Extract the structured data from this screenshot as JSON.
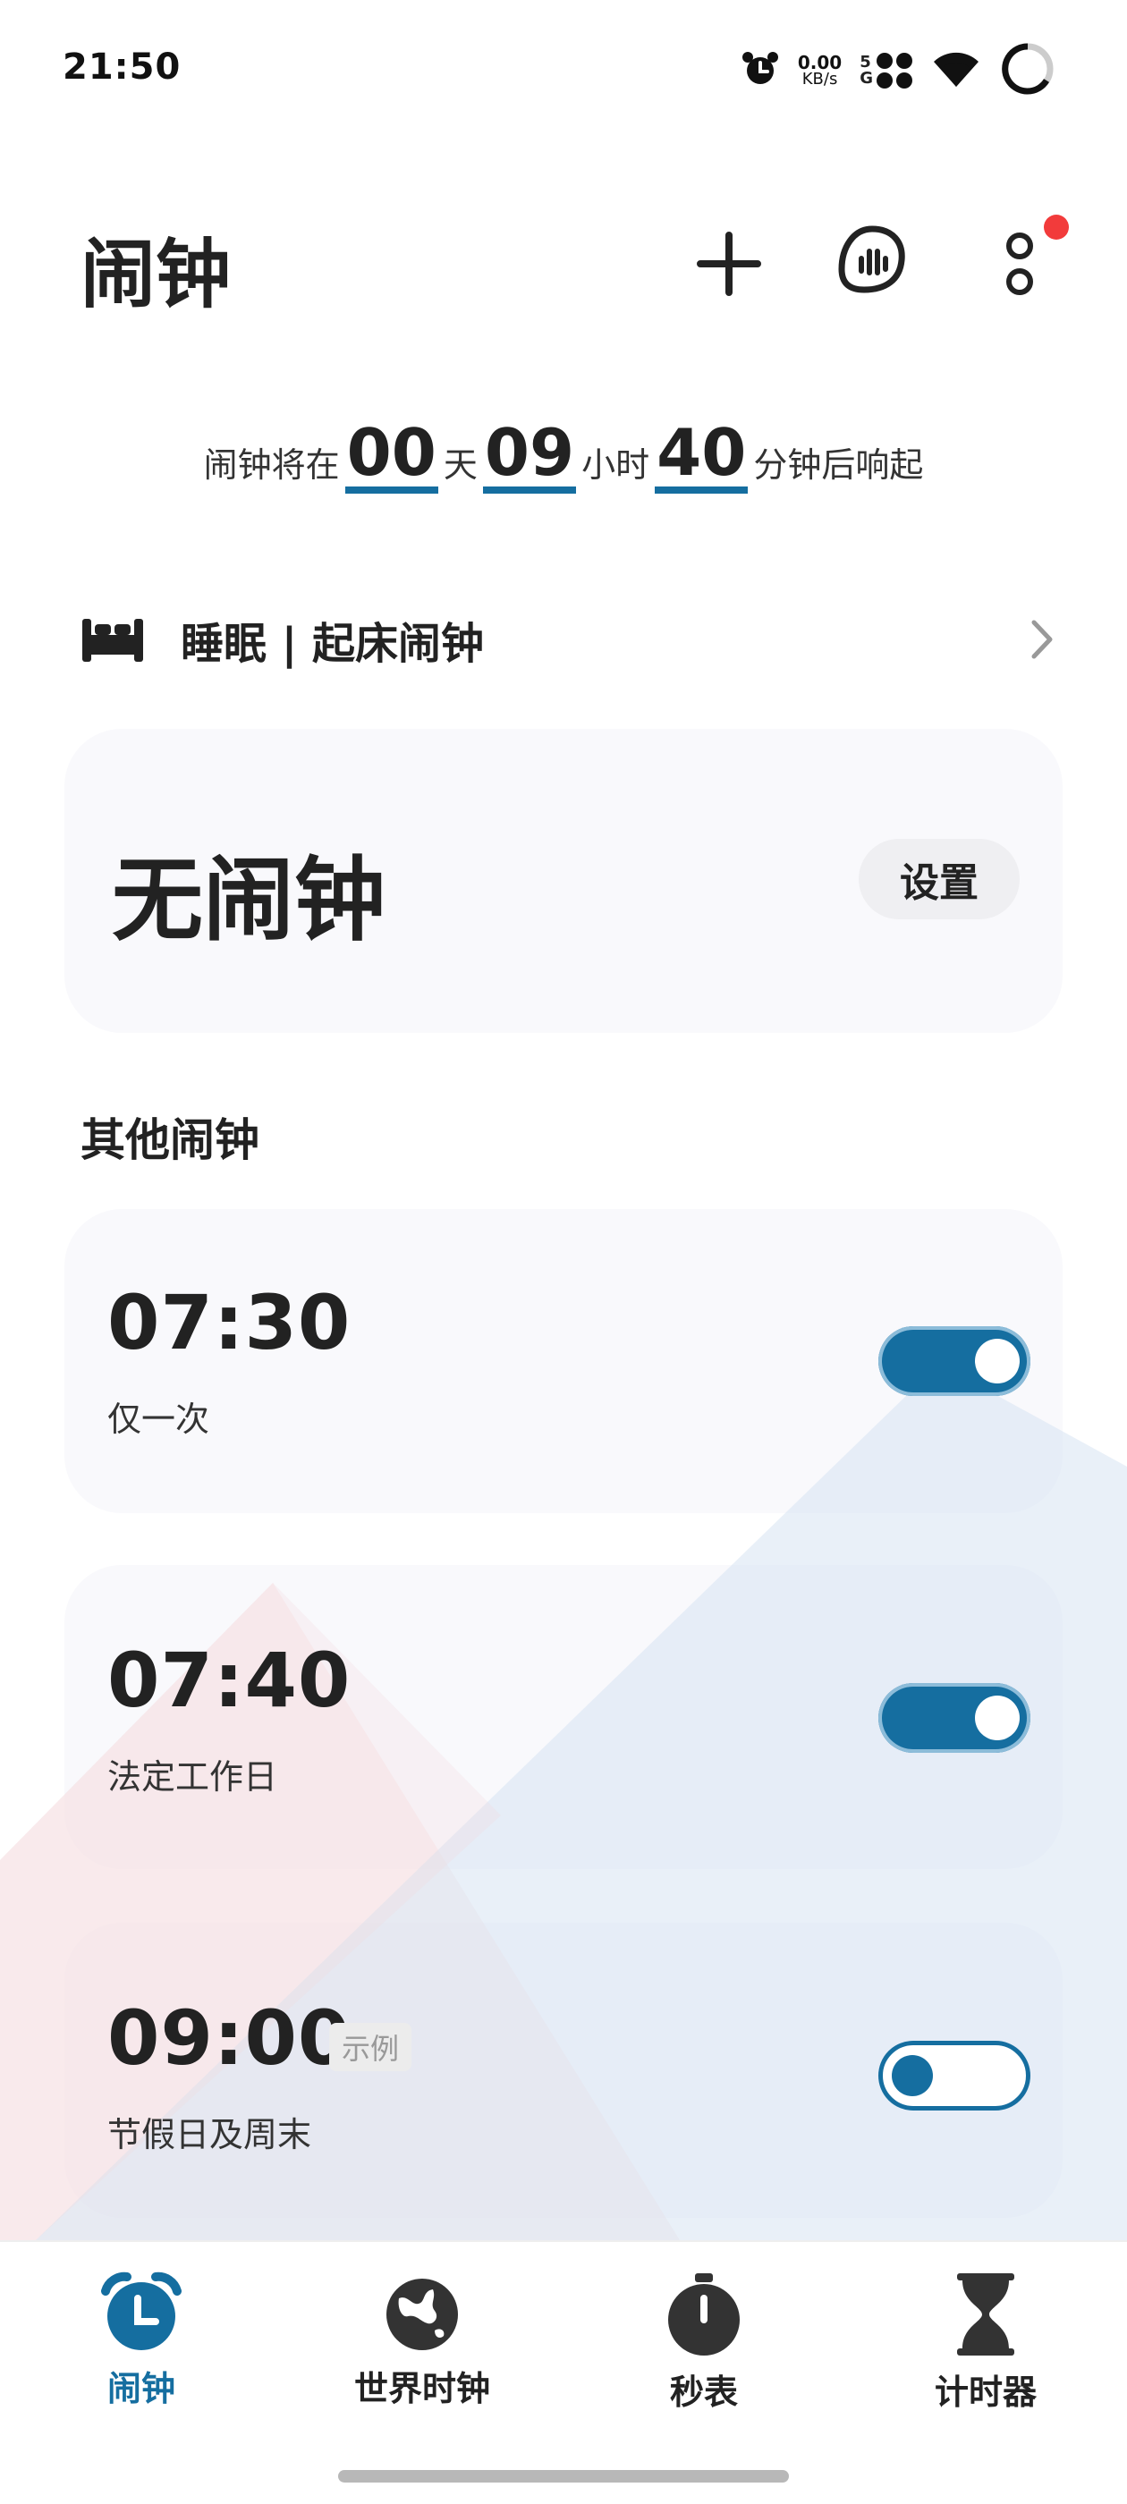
{
  "status_bar": {
    "time": "21:50",
    "net_speed_value": "0.00",
    "net_speed_unit": "KB/s",
    "network_5": "5",
    "network_g": "G",
    "icons": [
      "alarm-icon",
      "net-speed",
      "signal-icon",
      "wifi-icon",
      "battery-ring-icon"
    ]
  },
  "header": {
    "title": "闹钟",
    "actions": [
      "add-icon",
      "voice-icon",
      "more-icon"
    ],
    "notification_dot_color": "#f23b3b"
  },
  "countdown": {
    "prefix": "闹钟将在",
    "days": "00",
    "days_unit": "天",
    "hours": "09",
    "hours_unit": "小时",
    "minutes": "40",
    "suffix": "分钟后响起"
  },
  "sleep": {
    "label": "睡眠 | 起床闹钟"
  },
  "no_alarm_card": {
    "text": "无闹钟",
    "button": "设置"
  },
  "other_alarms": {
    "title": "其他闹钟",
    "items": [
      {
        "time": "07:30",
        "repeat": "仅一次",
        "enabled": true,
        "tag": ""
      },
      {
        "time": "07:40",
        "repeat": "法定工作日",
        "enabled": true,
        "tag": ""
      },
      {
        "time": "09:00",
        "repeat": "节假日及周末",
        "enabled": false,
        "tag": "示例"
      }
    ]
  },
  "bottom_nav": {
    "items": [
      {
        "label": "闹钟",
        "icon": "alarm-clock-icon",
        "active": true
      },
      {
        "label": "世界时钟",
        "icon": "globe-icon",
        "active": false
      },
      {
        "label": "秒表",
        "icon": "stopwatch-icon",
        "active": false
      },
      {
        "label": "计时器",
        "icon": "hourglass-icon",
        "active": false
      }
    ]
  },
  "colors": {
    "accent": "#156ea0",
    "card_bg": "#f9f9fc",
    "text": "#222222"
  }
}
